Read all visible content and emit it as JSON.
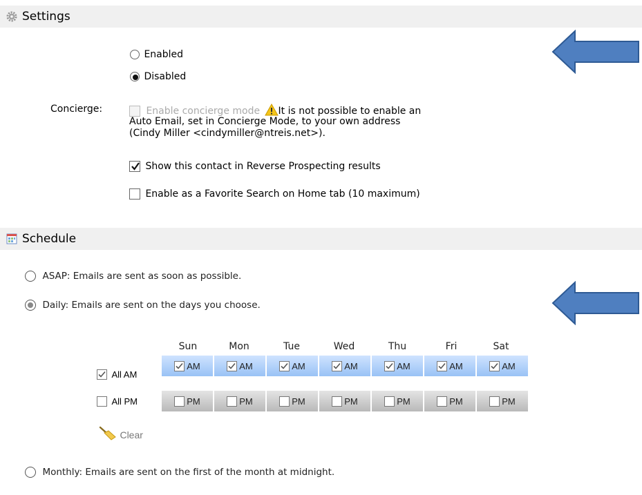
{
  "settings": {
    "title": "Settings",
    "enabled_label": "Enabled",
    "disabled_label": "Disabled",
    "concierge_label": "Concierge:",
    "enable_concierge_label": "Enable concierge mode",
    "warning_line1": "It is not possible to enable an",
    "warning_line2": "Auto Email, set in Concierge Mode, to your own address",
    "warning_line3": "(Cindy Miller <cindymiller@ntreis.net>).",
    "reverse_prospecting_label": "Show this contact in Reverse Prospecting results",
    "favorite_search_label": "Enable as a Favorite Search on Home tab (10 maximum)"
  },
  "schedule": {
    "title": "Schedule",
    "asap_label": "ASAP: Emails are sent as soon as possible.",
    "daily_label": "Daily: Emails are sent on the days you choose.",
    "monthly_label": "Monthly: Emails are sent on the first of the month at midnight.",
    "days": [
      "Sun",
      "Mon",
      "Tue",
      "Wed",
      "Thu",
      "Fri",
      "Sat"
    ],
    "all_am_label": "All AM",
    "all_pm_label": "All PM",
    "am_label": "AM",
    "pm_label": "PM",
    "clear_label": "Clear"
  },
  "colors": {
    "arrow_fill": "#4f7fc0",
    "arrow_stroke": "#2e5a94",
    "am_row": "#a9cbf7",
    "pm_row": "#c8c8c8",
    "header_bg": "#f0f0f0"
  }
}
